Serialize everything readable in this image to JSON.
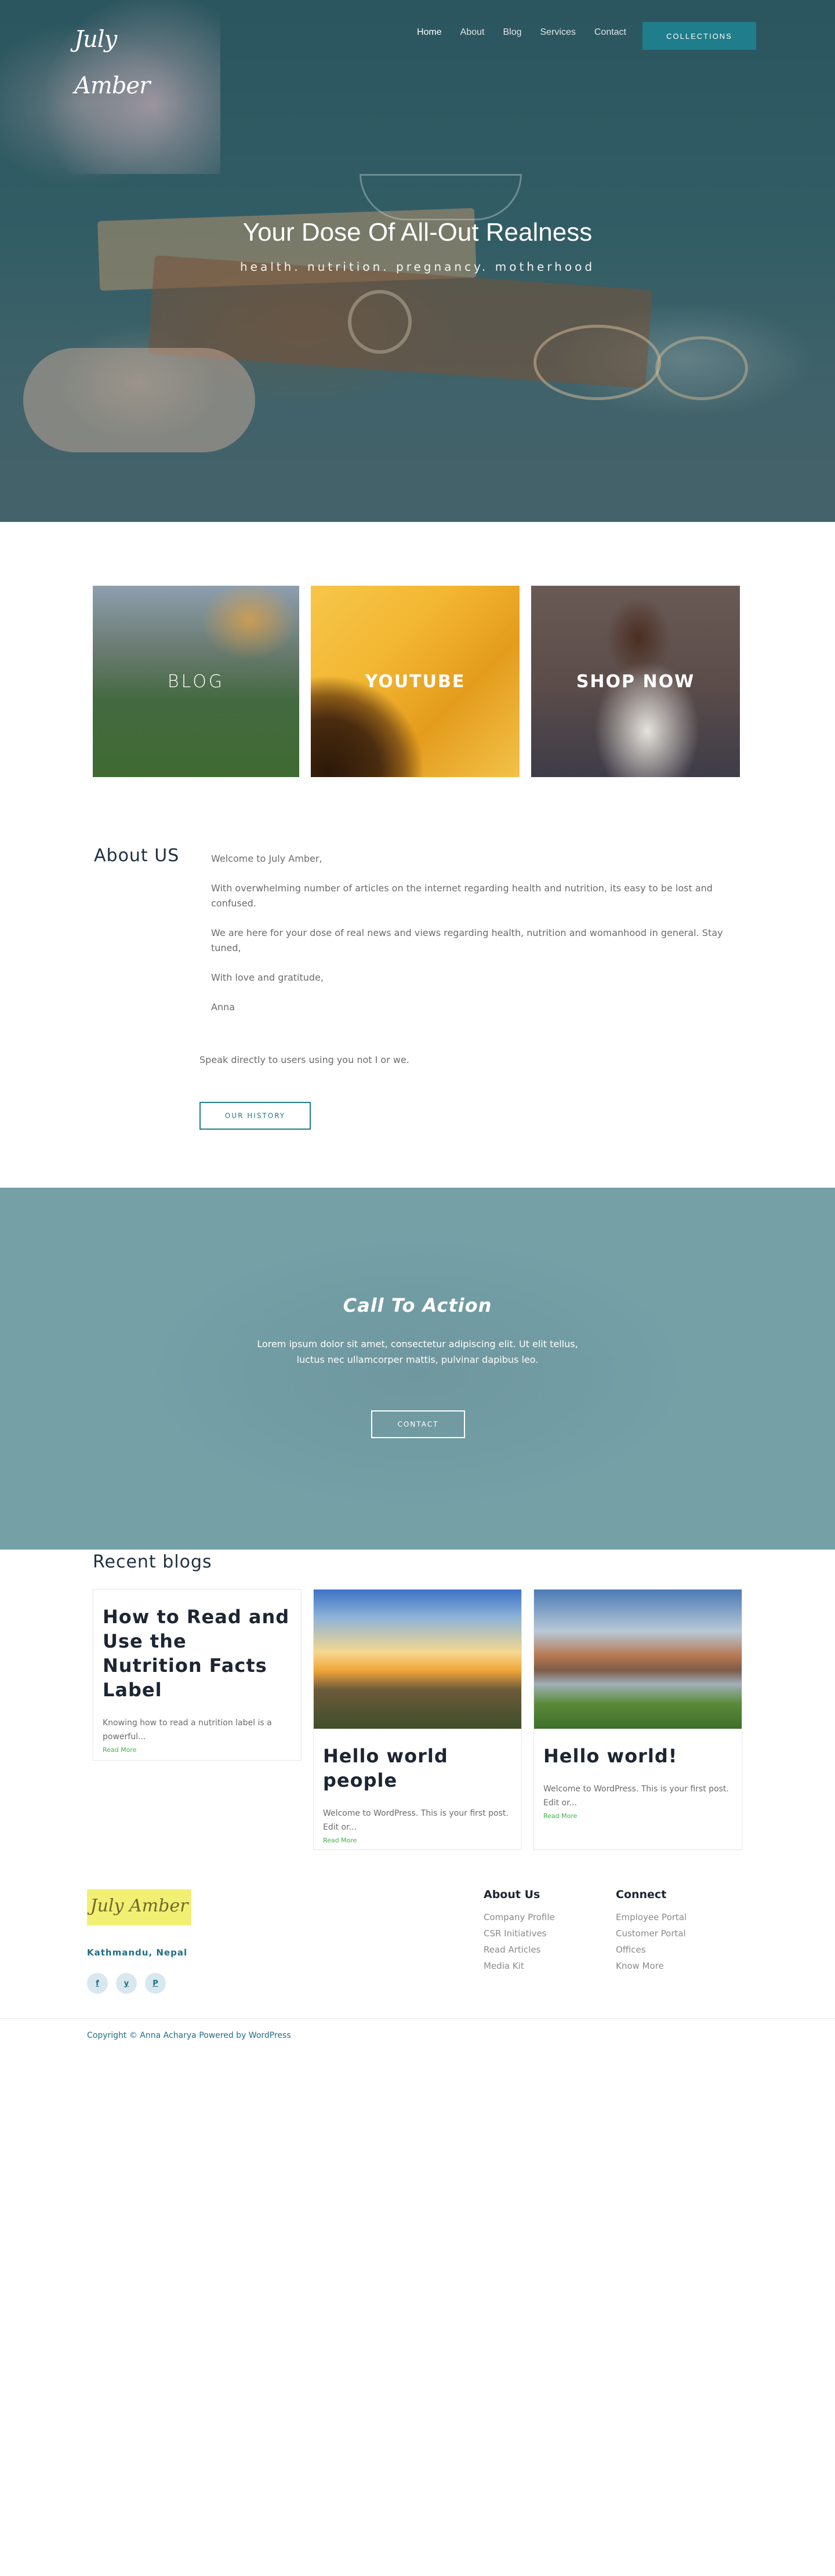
{
  "header": {
    "logo": "July Amber",
    "nav": [
      {
        "label": "Home"
      },
      {
        "label": "About"
      },
      {
        "label": "Blog"
      },
      {
        "label": "Services"
      },
      {
        "label": "Contact"
      }
    ],
    "collections_label": "COLLECTIONS"
  },
  "hero": {
    "title": "Your Dose Of All-Out Realness",
    "subtitle": "health. nutrition. pregnancy. motherhood"
  },
  "cards": [
    {
      "label": "BLOG"
    },
    {
      "label": "YOUTUBE"
    },
    {
      "label": "SHOP NOW"
    }
  ],
  "about": {
    "heading": "About US",
    "paragraphs": [
      "Welcome to July Amber,",
      "With overwhelming number of articles on the internet regarding health and nutrition, its easy to be lost and confused.",
      "We are here for your dose of real news and views regarding health, nutrition and womanhood in general. Stay tuned,",
      "With love and gratitude,",
      "Anna"
    ],
    "speak": "Speak directly to users using you not I or we.",
    "history_label": "OUR HISTORY"
  },
  "cta": {
    "title": "Call To Action",
    "text": "Lorem ipsum dolor sit amet, consectetur adipiscing elit. Ut elit tellus, luctus nec ullamcorper mattis, pulvinar dapibus leo.",
    "contact_label": "CONTACT"
  },
  "blogs": {
    "heading": "Recent blogs",
    "posts": [
      {
        "title": "How to Read and Use the Nutrition Facts Label",
        "excerpt": "Knowing how to read a nutrition label is a powerful...",
        "read_more": "Read More"
      },
      {
        "title": "Hello world people",
        "excerpt": "Welcome to WordPress. This is your first post. Edit or...",
        "read_more": "Read More"
      },
      {
        "title": "Hello world!",
        "excerpt": "Welcome to WordPress. This is your first post. Edit or...",
        "read_more": "Read More"
      }
    ]
  },
  "footer": {
    "logo": "July Amber",
    "location": "Kathmandu, Nepal",
    "socials": [
      "f",
      "y",
      "P"
    ],
    "about_heading": "About Us",
    "about_links": [
      "Company Profile",
      "CSR Initiatives",
      "Read Articles",
      "Media Kit"
    ],
    "connect_heading": "Connect",
    "connect_links": [
      "Employee Portal",
      "Customer Portal",
      "Offices",
      "Know More"
    ],
    "copyright": "Copyright © Anna Acharya Powered by WordPress"
  },
  "colors": {
    "accent": "#1f7d8c",
    "cta_bg": "#74a0a6",
    "read_more": "#3cb34a",
    "footer_logo_bg": "#f1f073"
  }
}
